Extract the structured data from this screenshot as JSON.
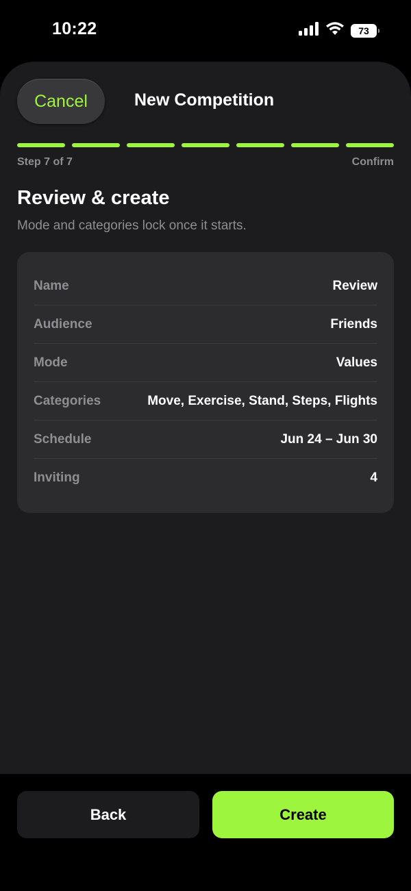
{
  "status_bar": {
    "time": "10:22",
    "battery": "73",
    "icons": [
      "cellular-signal-icon",
      "wifi-icon",
      "battery-icon"
    ]
  },
  "header": {
    "cancel_label": "Cancel",
    "title": "New Competition"
  },
  "progress": {
    "total_steps": 7,
    "completed_steps": 7,
    "step_label": "Step 7 of 7",
    "step_name": "Confirm"
  },
  "section": {
    "title": "Review & create",
    "subtitle": "Mode and categories lock once it starts."
  },
  "summary": {
    "rows": [
      {
        "label": "Name",
        "value": "Review"
      },
      {
        "label": "Audience",
        "value": "Friends"
      },
      {
        "label": "Mode",
        "value": "Values"
      },
      {
        "label": "Categories",
        "value": "Move, Exercise, Stand, Steps, Flights"
      },
      {
        "label": "Schedule",
        "value": "Jun 24 – Jun 30"
      },
      {
        "label": "Inviting",
        "value": "4"
      }
    ]
  },
  "footer": {
    "back_label": "Back",
    "create_label": "Create"
  },
  "colors": {
    "accent": "#9ef53d",
    "background": "#000000",
    "sheet": "#1c1c1e",
    "card": "#2c2c2e",
    "secondary_text": "#8e8e93"
  }
}
